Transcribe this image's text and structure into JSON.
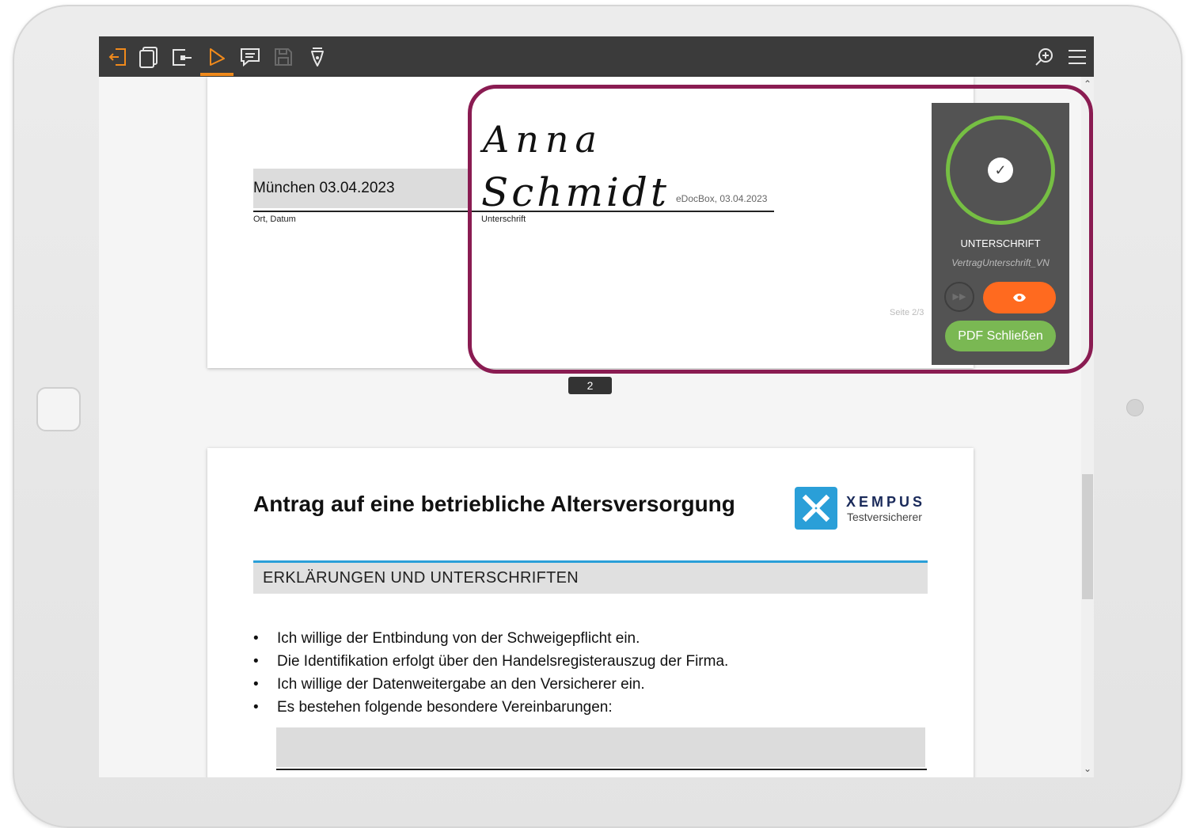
{
  "toolbar": {
    "icons": [
      "exit-icon",
      "pages-icon",
      "export-icon",
      "pointer-icon",
      "comment-icon",
      "save-icon",
      "sign-pen-icon",
      "zoom-icon",
      "menu-icon"
    ],
    "accent_color": "#f08a1c"
  },
  "page1": {
    "ort_value": "München 03.04.2023",
    "ort_label": "Ort, Datum",
    "signature_first": "Anna",
    "signature_last": "Schmidt",
    "signature_label": "Unterschrift",
    "signature_stamp": "eDocBox, 03.04.2023",
    "page_footer": "Seite 2/3"
  },
  "page_indicator": "2",
  "page2": {
    "title": "Antrag auf eine betriebliche Altersversorgung",
    "logo_name": "XEMPUS",
    "logo_sub": "Testversicherer",
    "section_title": "ERKLÄRUNGEN UND UNTERSCHRIFTEN",
    "bullets": [
      "Ich willige der Entbindung von der Schweigepflicht ein.",
      "Die Identifikation erfolgt über den Handelsregisterauszug der Firma.",
      "Ich willige der Datenweitergabe an den Versicherer ein.",
      "Es bestehen folgende besondere Vereinbarungen:"
    ]
  },
  "panel": {
    "title": "UNTERSCHRIFT",
    "subtitle": "VertragUnterschrift_VN",
    "close_label": "PDF Schließen",
    "ring_color": "#76bf43",
    "eye_button_color": "#ff6a1f",
    "close_button_color": "#7ab853"
  },
  "highlight_color": "#8a1c52"
}
